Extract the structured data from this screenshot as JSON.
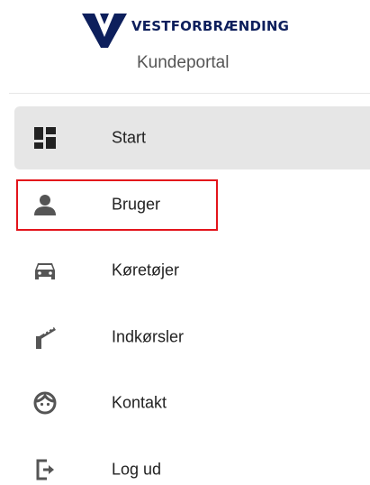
{
  "brand": {
    "logo_text": "VESTFORBRÆNDING",
    "portal_name": "Kundeportal",
    "logo_color": "#0d1f5c"
  },
  "nav": {
    "items": [
      {
        "label": "Start",
        "icon": "dashboard-icon",
        "active": true
      },
      {
        "label": "Bruger",
        "icon": "user-icon",
        "active": false,
        "highlighted": true
      },
      {
        "label": "Køretøjer",
        "icon": "car-icon",
        "active": false
      },
      {
        "label": "Indkørsler",
        "icon": "barrier-gate-icon",
        "active": false
      },
      {
        "label": "Kontakt",
        "icon": "face-icon",
        "active": false
      },
      {
        "label": "Log ud",
        "icon": "logout-icon",
        "active": false
      }
    ]
  },
  "colors": {
    "active_bg": "#e6e6e6",
    "icon": "#444444",
    "text": "#222222",
    "highlight": "#e3141b"
  }
}
